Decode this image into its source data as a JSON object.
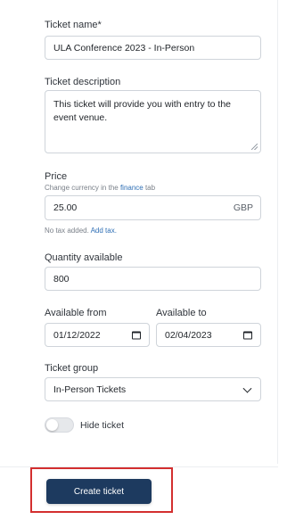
{
  "form": {
    "ticket_name": {
      "label": "Ticket name*",
      "value": "ULA Conference 2023 - In-Person"
    },
    "ticket_description": {
      "label": "Ticket description",
      "value": "This ticket will provide you with entry to the event venue."
    },
    "price": {
      "label": "Price",
      "helper_prefix": "Change currency in the ",
      "helper_link": "finance",
      "helper_suffix": " tab",
      "value": "25.00",
      "currency": "GBP",
      "tax_note": "No tax added.",
      "tax_link": "Add tax."
    },
    "quantity": {
      "label": "Quantity available",
      "value": "800"
    },
    "available_from": {
      "label": "Available from",
      "value": "01/12/2022"
    },
    "available_to": {
      "label": "Available to",
      "value": "02/04/2023"
    },
    "ticket_group": {
      "label": "Ticket group",
      "selected": "In-Person Tickets"
    },
    "hide_ticket": {
      "label": "Hide ticket",
      "enabled": false
    }
  },
  "actions": {
    "create_label": "Create ticket"
  },
  "colors": {
    "primary_button": "#1d3a5f",
    "link": "#2f6fb5",
    "highlight": "#d32f2f"
  }
}
